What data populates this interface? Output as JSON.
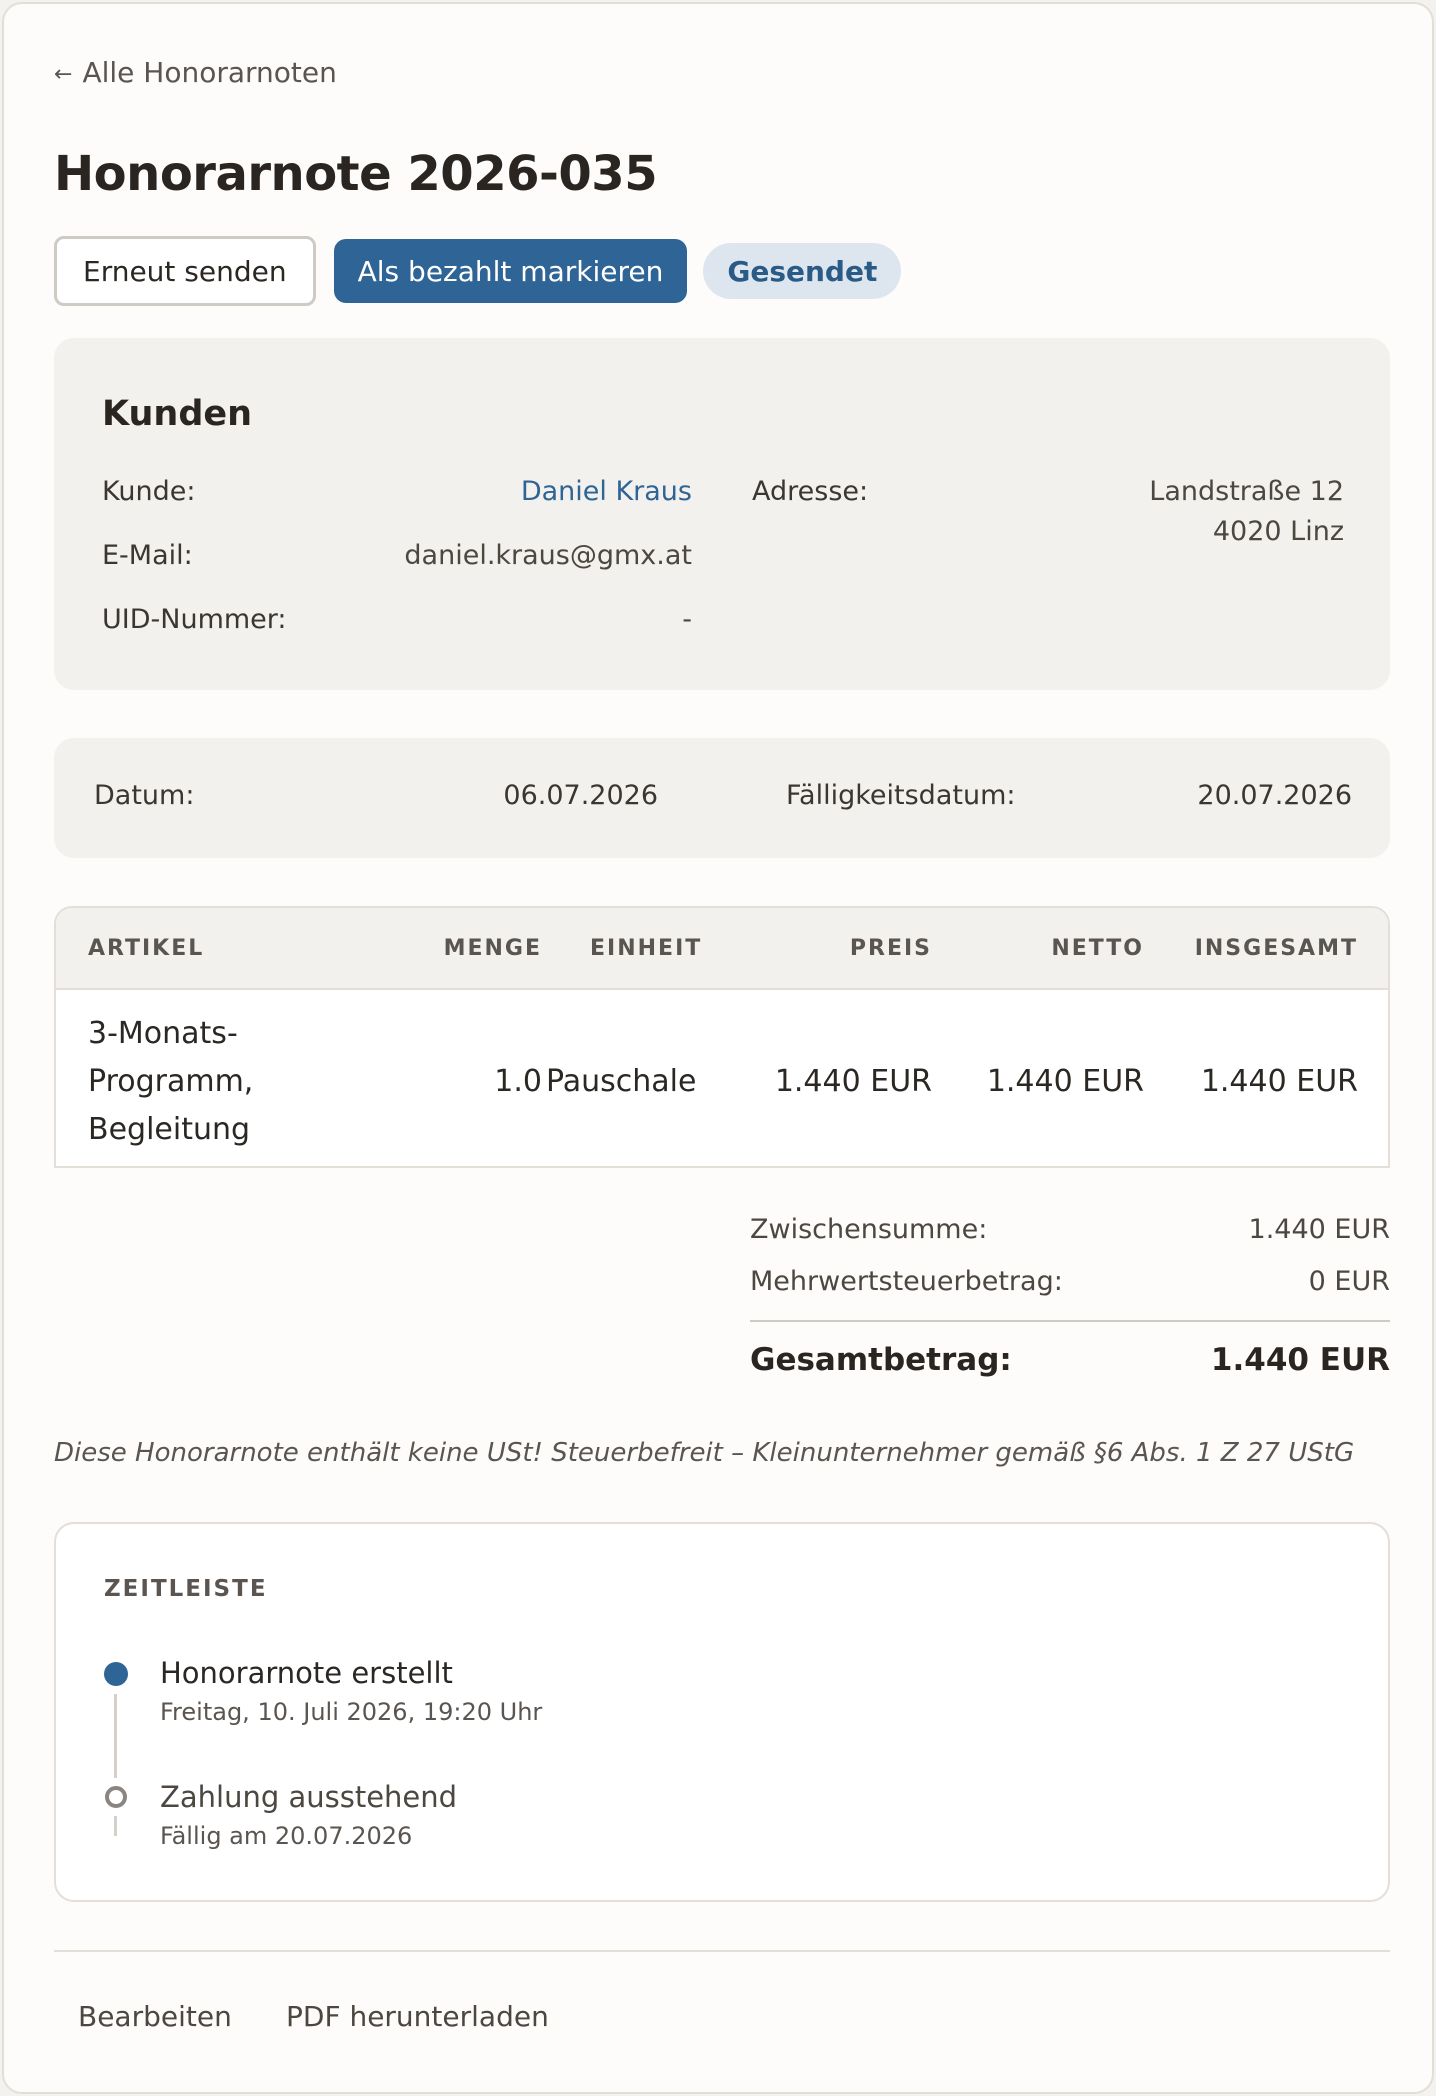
{
  "nav": {
    "back_label": "Alle Honorarnoten",
    "back_arrow": "←"
  },
  "page": {
    "title": "Honorarnote 2026-035"
  },
  "actions": {
    "resend_label": "Erneut senden",
    "mark_paid_label": "Als bezahlt markieren",
    "status_badge": "Gesendet"
  },
  "customer": {
    "heading": "Kunden",
    "name_label": "Kunde:",
    "name_value": "Daniel Kraus",
    "email_label": "E-Mail:",
    "email_value": "daniel.kraus@gmx.at",
    "uid_label": "UID-Nummer:",
    "uid_value": "-",
    "address_label": "Adresse:",
    "address_line1": "Landstraße 12",
    "address_line2": "4020 Linz"
  },
  "dates": {
    "date_label": "Datum:",
    "date_value": "06.07.2026",
    "due_label": "Fälligkeitsdatum:",
    "due_value": "20.07.2026"
  },
  "table": {
    "headers": [
      "ARTIKEL",
      "MENGE",
      "EINHEIT",
      "PREIS",
      "NETTO",
      "INSGESAMT"
    ],
    "rows": [
      {
        "article_line1": "3-Monats-",
        "article_line2": "Programm,",
        "article_line3": "Begleitung",
        "quantity": "1.0",
        "unit": "Pauschale",
        "price": "1.440 EUR",
        "net": "1.440 EUR",
        "total": "1.440 EUR"
      }
    ]
  },
  "totals": {
    "subtotal_label": "Zwischensumme:",
    "subtotal_value": "1.440 EUR",
    "vat_label": "Mehrwertsteuerbetrag:",
    "vat_value": "0 EUR",
    "total_label": "Gesamtbetrag:",
    "total_value": "1.440 EUR"
  },
  "note": "Diese Honorarnote enthält keine USt! Steuerbefreit – Kleinunternehmer gemäß §6 Abs. 1 Z 27 UStG",
  "timeline": {
    "heading": "ZEITLEISTE",
    "events": [
      {
        "title": "Honorarnote erstellt",
        "subtitle": "Freitag, 10. Juli 2026, 19:20 Uhr",
        "state": "done"
      },
      {
        "title": "Zahlung ausstehend",
        "subtitle": "Fällig am 20.07.2026",
        "state": "pending"
      }
    ]
  },
  "footer": {
    "edit_label": "Bearbeiten",
    "pdf_label": "PDF herunterladen"
  },
  "colors": {
    "accent": "#2e6496",
    "badge_bg": "#dde6ef",
    "panel_bg": "#f3f1ed",
    "page_bg": "#fdfcfa"
  }
}
